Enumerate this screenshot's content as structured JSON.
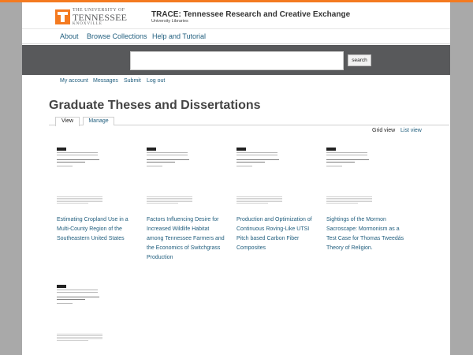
{
  "colors": {
    "accent": "#f47a20",
    "link": "#1f5d7d",
    "band": "#58595b"
  },
  "logo": {
    "line1": "THE UNIVERSITY OF",
    "line2": "TENNESSEE",
    "line3": "KNOXVILLE"
  },
  "site": {
    "title": "TRACE: Tennessee Research and Creative Exchange",
    "subtitle": "University Libraries"
  },
  "nav": [
    "About",
    "Browse Collections",
    "Help and Tutorial"
  ],
  "search": {
    "placeholder": "",
    "button_label": "search"
  },
  "user_links": [
    "My account",
    "Messages",
    "Submit",
    "Log out"
  ],
  "page": {
    "title": "Graduate Theses and Dissertations"
  },
  "tabs": [
    {
      "label": "View",
      "active": true
    },
    {
      "label": "Manage",
      "active": false
    }
  ],
  "view_options": {
    "grid": "Grid view",
    "list": "List view"
  },
  "items": [
    {
      "title_lines": [
        "Estimating Cropland Use in a",
        "Multi-County Region of the",
        "Southeastern United States"
      ]
    },
    {
      "title_lines": [
        "Factors Influencing Desire for",
        "Increased Wildlife Habitat",
        "among Tennessee Farmers and",
        "the Economics of Switchgrass",
        "Production"
      ]
    },
    {
      "title_lines": [
        "Production and Optimization of",
        "Continuous Roving-Like UTSI",
        "Pitch based Carbon Fiber",
        "Composites"
      ]
    },
    {
      "title_lines": [
        "Sightings of the Mormon",
        "Sacroscape: Mormonism as a",
        "Test Case for Thomas Tweedás",
        "Theory of Religion."
      ]
    },
    {
      "title_lines": []
    }
  ]
}
